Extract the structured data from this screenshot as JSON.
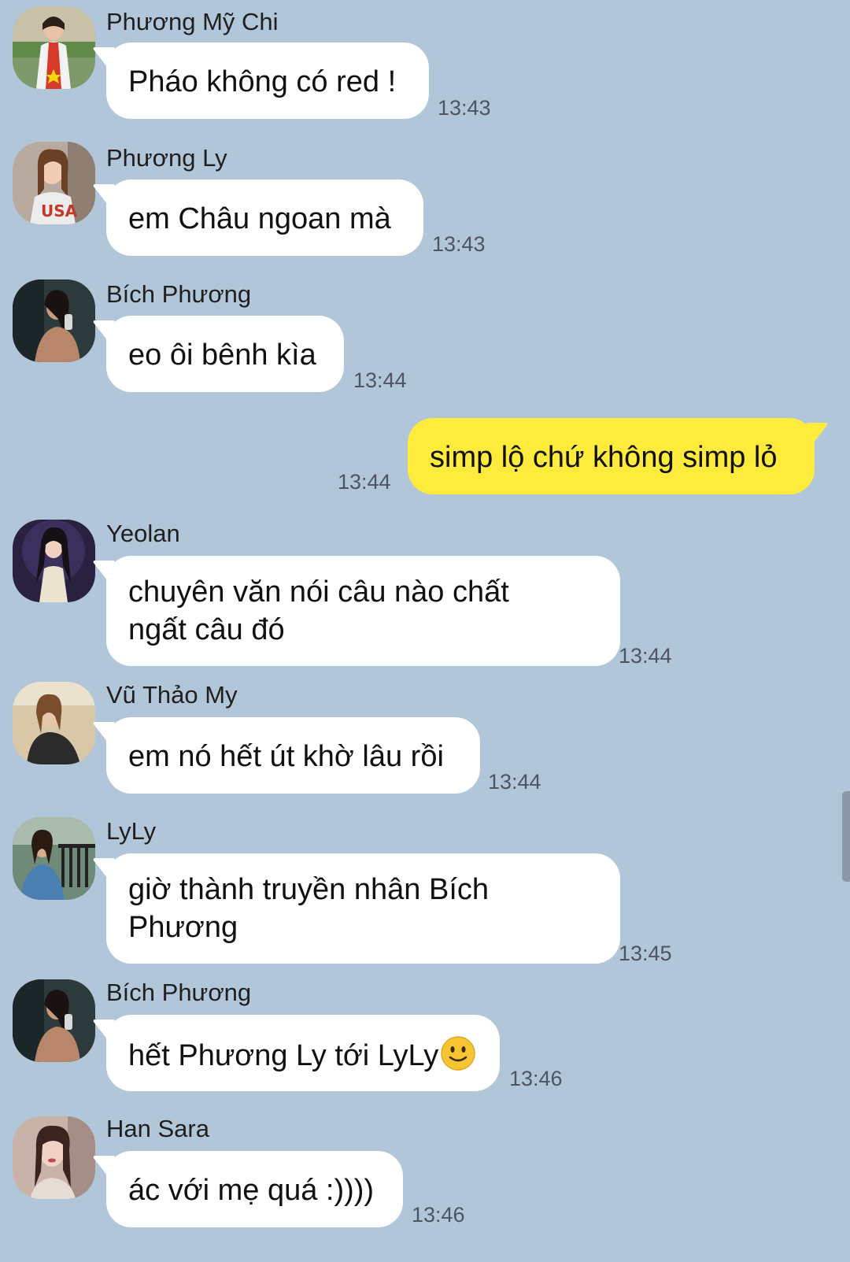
{
  "colors": {
    "background": "#b2c6da",
    "incoming_bubble": "#ffffff",
    "outgoing_bubble": "#ffeb3b",
    "timestamp": "#4c5661"
  },
  "messages": [
    {
      "sender": "Phương Mỹ Chi",
      "text": "Pháo không có red !",
      "time": "13:43",
      "avatar_icon": "avatar-phuong-my-chi"
    },
    {
      "sender": "Phương Ly",
      "text": "em Châu ngoan mà",
      "time": "13:43",
      "avatar_icon": "avatar-phuong-ly"
    },
    {
      "sender": "Bích Phương",
      "text": "eo ôi bênh kìa",
      "time": "13:44",
      "avatar_icon": "avatar-bich-phuong"
    },
    {
      "sender": "",
      "text": "simp lộ chứ không simp lỏ",
      "time": "13:44",
      "outgoing": true
    },
    {
      "sender": "Yeolan",
      "text_line1": "chuyên văn nói câu nào chất",
      "text_line2": "ngất câu đó",
      "time": "13:44",
      "avatar_icon": "avatar-yeolan"
    },
    {
      "sender": "Vũ Thảo My",
      "text": "em nó hết út khờ lâu rồi",
      "time": "13:44",
      "avatar_icon": "avatar-vu-thao-my"
    },
    {
      "sender": "LyLy",
      "text_line1": "giờ thành truyền nhân Bích",
      "text_line2": "Phương",
      "time": "13:45",
      "avatar_icon": "avatar-lyly"
    },
    {
      "sender": "Bích Phương",
      "text": "hết Phương Ly tới LyLy",
      "emoji": "slightly-smiling-face-icon",
      "time": "13:46",
      "avatar_icon": "avatar-bich-phuong"
    },
    {
      "sender": "Han Sara",
      "text": "ác với mẹ quá :))))",
      "time": "13:46",
      "avatar_icon": "avatar-han-sara"
    }
  ]
}
